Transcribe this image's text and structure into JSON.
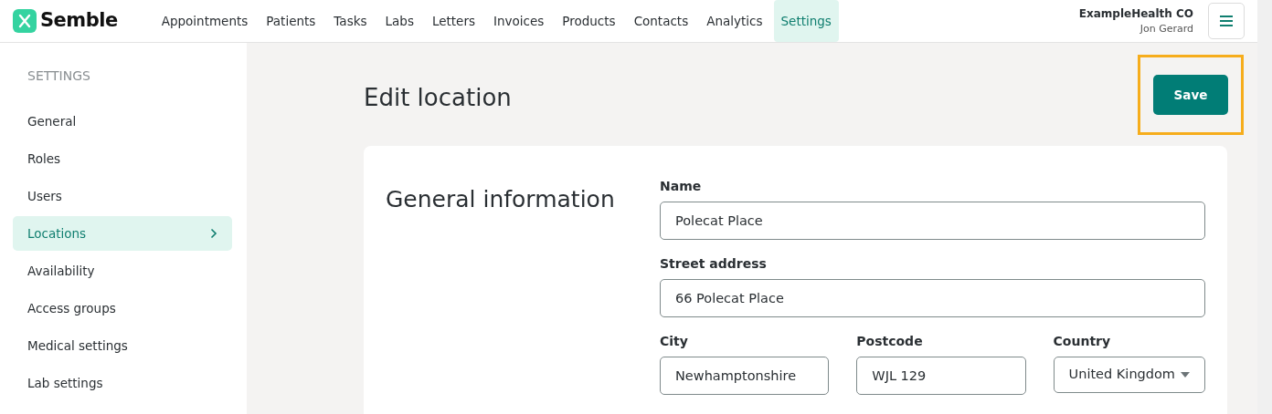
{
  "brand": {
    "name": "Semble"
  },
  "nav": [
    {
      "label": "Appointments",
      "selected": false
    },
    {
      "label": "Patients",
      "selected": false
    },
    {
      "label": "Tasks",
      "selected": false
    },
    {
      "label": "Labs",
      "selected": false
    },
    {
      "label": "Letters",
      "selected": false
    },
    {
      "label": "Invoices",
      "selected": false
    },
    {
      "label": "Products",
      "selected": false
    },
    {
      "label": "Contacts",
      "selected": false
    },
    {
      "label": "Analytics",
      "selected": false
    },
    {
      "label": "Settings",
      "selected": true
    }
  ],
  "account": {
    "organisation": "ExampleHealth CO",
    "user": "Jon Gerard"
  },
  "sidebar": {
    "heading": "SETTINGS",
    "items": [
      {
        "label": "General",
        "selected": false
      },
      {
        "label": "Roles",
        "selected": false
      },
      {
        "label": "Users",
        "selected": false
      },
      {
        "label": "Locations",
        "selected": true
      },
      {
        "label": "Availability",
        "selected": false
      },
      {
        "label": "Access groups",
        "selected": false
      },
      {
        "label": "Medical settings",
        "selected": false
      },
      {
        "label": "Lab settings",
        "selected": false
      }
    ]
  },
  "page": {
    "title": "Edit location",
    "save_button": "Save",
    "save_highlighted": true
  },
  "section": {
    "title": "General information",
    "fields": [
      {
        "label": "Name",
        "value": "Polecat Place"
      },
      {
        "label": "Street address",
        "value": "66 Polecat Place"
      }
    ],
    "address_row": [
      {
        "label": "City",
        "value": "Newhamptonshire",
        "kind": "text"
      },
      {
        "label": "Postcode",
        "value": "WJL 129",
        "kind": "text"
      },
      {
        "label": "Country",
        "value": "United Kingdom",
        "kind": "select"
      }
    ]
  }
}
